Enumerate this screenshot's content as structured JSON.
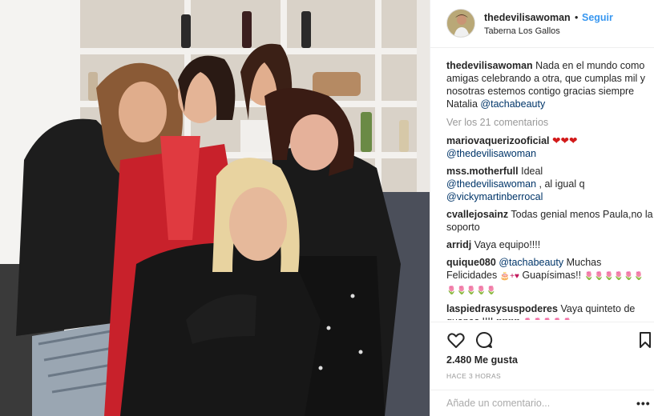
{
  "post": {
    "username": "thedevilisawoman",
    "separator": "•",
    "follow_label": "Seguir",
    "location": "Taberna Los Gallos",
    "photo_icon": "group-photo"
  },
  "caption": {
    "username": "thedevilisawoman",
    "text": "Nada en el mundo como amigas celebrando a otra, que cumplas mil y nosotras estemos contigo gracias siempre Natalia",
    "mention": "@tachabeauty"
  },
  "view_all_label": "Ver los 21 comentarios",
  "comments": [
    {
      "user": "mariovaquerizooficial",
      "text": "❤❤❤",
      "mention": "@thedevilisawoman"
    },
    {
      "user": "mss.motherfull",
      "text": "Ideal",
      "mention1": "@thedevilisawoman",
      "mid": " , al igual q",
      "mention2": "@vickymartinberrocal"
    },
    {
      "user": "cvallejosainz",
      "text": "Todas genial menos Paula,no la soporto"
    },
    {
      "user": "arridj",
      "text": "Vaya equipo!!!!"
    },
    {
      "user": "quique080",
      "mention": "@tachabeauty",
      "text": "Muchas Felicidades",
      "text2": "Guapísimas!!",
      "emojis": "🌷🌷🌷🌷🌷🌷🌷🌷🌷🌷🌷"
    },
    {
      "user": "laspiedrasysuspoderes",
      "text": "Vaya quinteto de guapas !!!! ",
      "hearts": "♥♥♥♥",
      "emojis": "🌷🌷🌷🌷🌷"
    }
  ],
  "likes": "2.480 Me gusta",
  "time": "HACE 3 HORAS",
  "add_comment_placeholder": "Añade un comentario...",
  "more_label": "•••",
  "icons": {
    "like": "heart-icon",
    "comment": "comment-icon",
    "save": "bookmark-icon"
  }
}
